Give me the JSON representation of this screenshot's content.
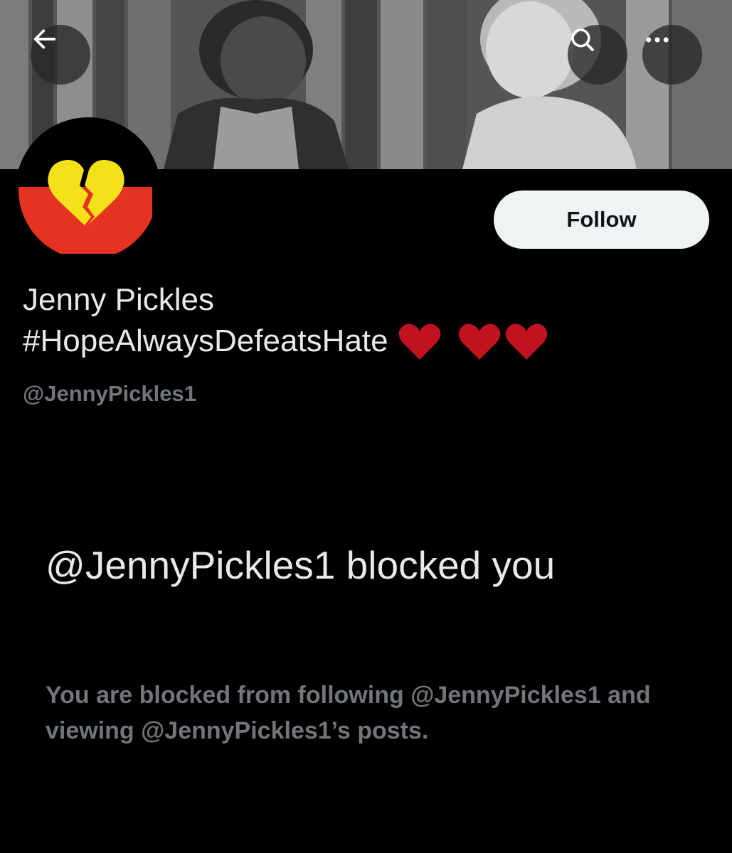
{
  "header": {
    "back_icon": "arrow-left-icon",
    "search_icon": "search-icon",
    "more_icon": "more-dots-icon"
  },
  "profile": {
    "display_name_line1": "Jenny Pickles",
    "display_name_line2": "#HopeAlwaysDefeatsHate",
    "handle": "@JennyPickles1",
    "avatar_icon": "broken-heart-icon",
    "follow_label": "Follow"
  },
  "blocked": {
    "title": "@JennyPickles1 blocked you",
    "description": "You are blocked from following @JennyPickles1 and viewing @JennyPickles1’s posts."
  },
  "colors": {
    "background": "#000000",
    "primary_text": "#e7e9ea",
    "secondary_text": "#71767b",
    "follow_bg": "#eff3f4",
    "heart_red": "#c1121f",
    "flag_red": "#e63222",
    "heart_yellow": "#f5e11a"
  }
}
